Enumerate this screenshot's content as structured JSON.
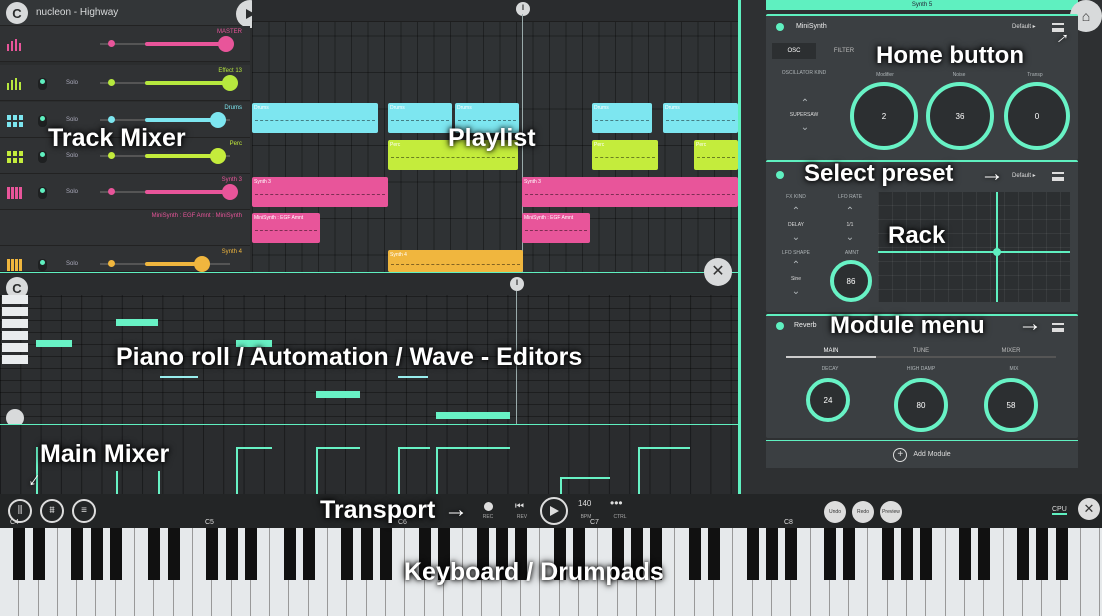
{
  "app": {
    "title": "nucleon - Highway",
    "logo": "fl-studio-logo"
  },
  "tracks": [
    {
      "name": "MASTER",
      "solo": "",
      "color": "#e8559a",
      "icon": "bars-icon"
    },
    {
      "name": "Effect 13",
      "solo": "Solo",
      "color": "#b6e83e",
      "icon": "bars-icon"
    },
    {
      "name": "Drums",
      "solo": "Solo",
      "color": "#7de6f0",
      "icon": "drumpad-icon"
    },
    {
      "name": "Perc",
      "solo": "Solo",
      "color": "#c4ec3c",
      "icon": "drumpad-icon"
    },
    {
      "name": "Synth 3",
      "solo": "Solo",
      "color": "#e8559a",
      "icon": "piano-icon"
    },
    {
      "name": "MiniSynth : EGF Amnt : MiniSynth",
      "solo": "",
      "color": "#e8559a",
      "icon": ""
    },
    {
      "name": "Synth 4",
      "solo": "Solo",
      "color": "#f0b63e",
      "icon": "piano-icon"
    }
  ],
  "clips": {
    "drums": "Drums",
    "perc": "Perc",
    "synth3": "Synth 3",
    "auto": "MiniSynth : EGF Amnt",
    "synth4": "Synth 4"
  },
  "rack": {
    "header": "Synth 5",
    "minisynth": {
      "name": "MiniSynth",
      "preset": "Default ▸",
      "tabs": [
        "OSC",
        "FILTER"
      ],
      "osc_kind_label": "OSCILLATOR KIND",
      "osc_kind": "SUPERSAW",
      "dials": [
        {
          "label": "Modifier",
          "value": "2"
        },
        {
          "label": "Noise",
          "value": "36"
        },
        {
          "label": "Transp",
          "value": "0"
        }
      ]
    },
    "fx": {
      "preset": "Default ▸",
      "fx_kind_label": "FX KIND",
      "fx_kind": "DELAY",
      "lfo_rate_label": "LFO RATE",
      "lfo_rate": "1/1",
      "lfo_shape_label": "LFO SHAPE",
      "lfo_shape": "Sine",
      "amnt_label": "AMNT",
      "amnt": "86"
    },
    "reverb": {
      "name": "Reverb",
      "tabs": [
        "MAIN",
        "TUNE",
        "MIXER"
      ],
      "dials": [
        {
          "label": "DECAY",
          "value": "24"
        },
        {
          "label": "HIGH DAMP",
          "value": "80"
        },
        {
          "label": "MIX",
          "value": "58"
        }
      ]
    },
    "add_module": "Add Module"
  },
  "transport": {
    "rec": "REC",
    "rev": "REV",
    "bpm_value": "140",
    "bpm_label": "BPM",
    "ctrl": "CTRL",
    "undo": "Undo",
    "redo": "Redo",
    "preview": "Preview",
    "cpu": "CPU"
  },
  "octaves": [
    "C4",
    "C5",
    "C6",
    "C7",
    "C8"
  ],
  "annotations": {
    "track_mixer": "Track Mixer",
    "playlist": "Playlist",
    "home_button": "Home button",
    "select_preset": "Select preset",
    "rack": "Rack",
    "module_menu": "Module menu",
    "piano_roll": "Piano roll / Automation / Wave - Editors",
    "main_mixer": "Main Mixer",
    "transport": "Transport",
    "keyboard": "Keyboard / Drumpads",
    "arrow": "→"
  },
  "colors": {
    "accent": "#5ff0c0",
    "pink": "#e8559a",
    "cyan": "#7de6f0",
    "lime": "#c4ec3c",
    "orange": "#f0b63e"
  }
}
